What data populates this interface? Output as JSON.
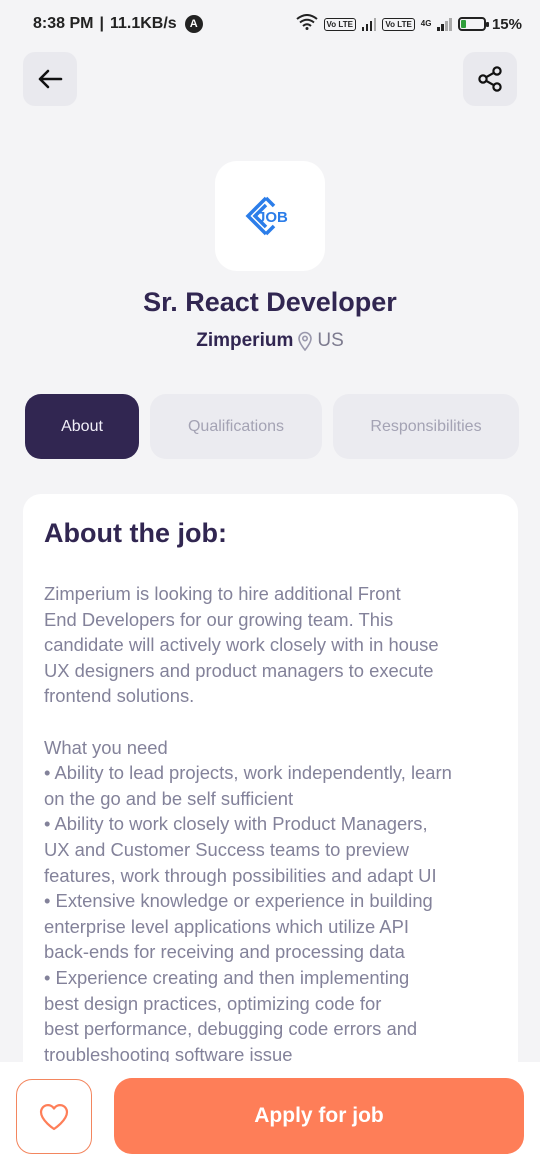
{
  "status_bar": {
    "time": "8:38 PM",
    "separator": "|",
    "speed": "11.1KB/s",
    "nav_badge": "A",
    "sim1_label": "Vo LTE",
    "sim2_label": "Vo LTE",
    "network": "4G",
    "battery": "15%"
  },
  "header": {
    "back_icon": "arrow-left-icon",
    "share_icon": "share-icon"
  },
  "company": {
    "logo_text": "JOB",
    "logo_color": "#2b7de9",
    "job_title": "Sr. React Developer",
    "name": "Zimperium",
    "location": "US"
  },
  "tabs": [
    {
      "label": "About",
      "active": true
    },
    {
      "label": "Qualifications",
      "active": false
    },
    {
      "label": "Responsibilities",
      "active": false
    }
  ],
  "about": {
    "heading": "About the job:",
    "body": "Zimperium is looking to hire additional Front\nEnd Developers for our growing team. This\ncandidate will actively work closely with in house\nUX designers and product managers to execute\nfrontend solutions.\n\nWhat you need\n• Ability to lead projects, work independently, learn\non the go and be self sufficient\n• Ability to work closely with Product Managers,\nUX and Customer Success teams to preview\nfeatures, work through possibilities and adapt UI\n• Extensive knowledge or experience in building\nenterprise level applications which utilize API\nback-ends for receiving and processing data\n• Experience creating and then implementing\nbest design practices, optimizing code for\nbest performance, debugging code errors and\ntroubleshooting software issue"
  },
  "footer": {
    "like_icon": "heart-icon",
    "apply_label": "Apply for job",
    "accent_color": "#fe7e58"
  },
  "colors": {
    "primary": "#312651",
    "secondary": "#83829a",
    "background": "#f4f4f6"
  }
}
